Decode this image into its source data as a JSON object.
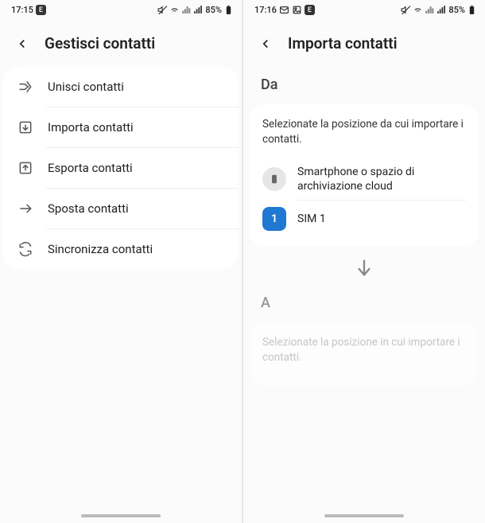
{
  "left": {
    "status": {
      "time": "17:15",
      "battery": "85%"
    },
    "title": "Gestisci contatti",
    "items": [
      {
        "label": "Unisci contatti"
      },
      {
        "label": "Importa contatti"
      },
      {
        "label": "Esporta contatti"
      },
      {
        "label": "Sposta contatti"
      },
      {
        "label": "Sincronizza contatti"
      }
    ]
  },
  "right": {
    "status": {
      "time": "17:16",
      "battery": "85%"
    },
    "title": "Importa contatti",
    "section_from": "Da",
    "from_desc": "Selezionate la posizione da cui importare i contatti.",
    "from_options": [
      {
        "label": "Smartphone o spazio di archiviazione cloud"
      },
      {
        "label": "SIM 1",
        "badge": "1"
      }
    ],
    "section_to": "A",
    "to_desc": "Selezionate la posizione in cui importare i contatti."
  }
}
